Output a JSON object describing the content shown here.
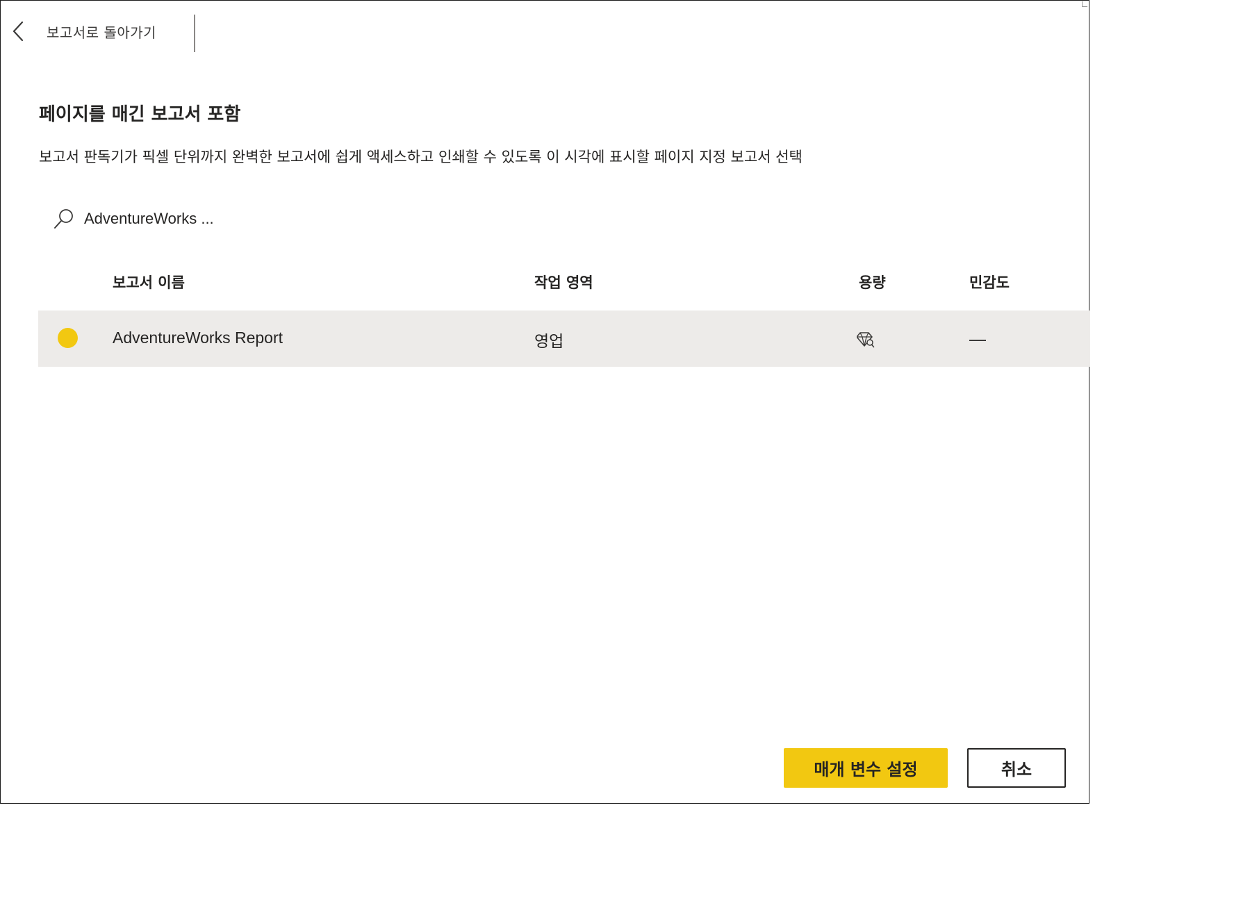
{
  "header": {
    "back_label": "보고서로 돌아가기"
  },
  "main": {
    "title": "페이지를 매긴 보고서 포함",
    "description": "보고서 판독기가 픽셀 단위까지 완벽한 보고서에 쉽게 액세스하고 인쇄할 수 있도록 이 시각에 표시할 페이지 지정 보고서 선택"
  },
  "search": {
    "value": "AdventureWorks ..."
  },
  "table": {
    "columns": [
      "보고서 이름",
      "작업 영역",
      "용량",
      "민감도"
    ],
    "rows": [
      {
        "name": "AdventureWorks Report",
        "workspace": "영업",
        "capacity_icon": "diamond-icon",
        "sensitivity": "—",
        "selected": true
      }
    ]
  },
  "footer": {
    "primary_label": "매개 변수 설정",
    "cancel_label": "취소"
  },
  "colors": {
    "accent": "#f2c811",
    "row_selected_bg": "#edebe9",
    "text": "#252423"
  }
}
